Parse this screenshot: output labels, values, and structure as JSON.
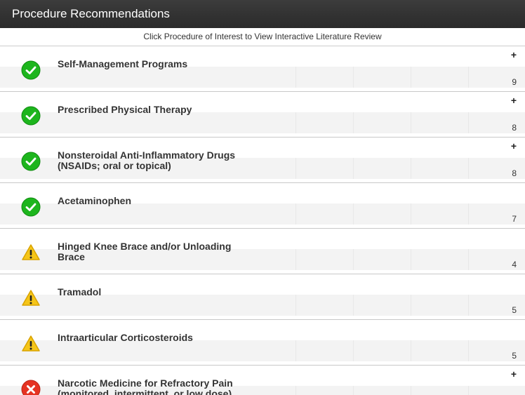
{
  "header": {
    "title": "Procedure Recommendations"
  },
  "subheader": {
    "text": "Click Procedure of Interest to View Interactive Literature Review"
  },
  "procedures": [
    {
      "label": "Self-Management Programs",
      "count": "9",
      "plus": "+",
      "status": "recommended"
    },
    {
      "label": "Prescribed Physical Therapy",
      "count": "8",
      "plus": "+",
      "status": "recommended"
    },
    {
      "label": "Nonsteroidal Anti-Inflammatory Drugs (NSAIDs; oral or topical)",
      "count": "8",
      "plus": "+",
      "status": "recommended"
    },
    {
      "label": "Acetaminophen",
      "count": "7",
      "plus": "",
      "status": "recommended"
    },
    {
      "label": "Hinged Knee Brace and/or Unloading Brace",
      "count": "4",
      "plus": "",
      "status": "caution"
    },
    {
      "label": "Tramadol",
      "count": "5",
      "plus": "",
      "status": "caution"
    },
    {
      "label": "Intraarticular Corticosteroids",
      "count": "5",
      "plus": "",
      "status": "caution"
    },
    {
      "label": "Narcotic Medicine for Refractory Pain (monitored, intermittent, or low dose)",
      "count": "",
      "plus": "+",
      "status": "not-recommended"
    }
  ],
  "colors": {
    "recommended": "#1db51d",
    "caution": "#f5c518",
    "not_recommended": "#e53322"
  },
  "icons": {
    "recommended": "check-circle-icon",
    "caution": "warning-triangle-icon",
    "not-recommended": "x-circle-icon"
  }
}
